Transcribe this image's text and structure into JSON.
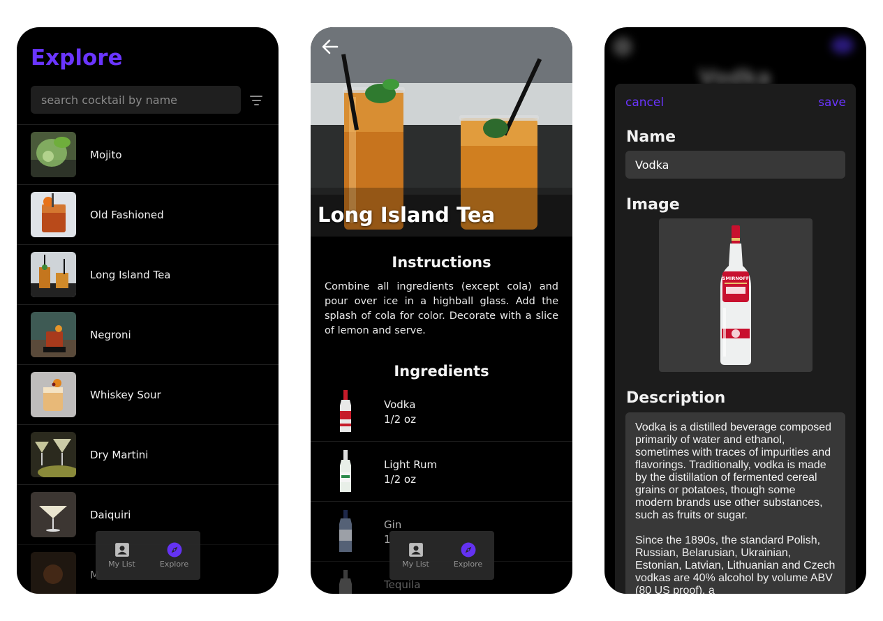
{
  "explore": {
    "title": "Explore",
    "search_placeholder": "search cocktail by name",
    "cocktails": [
      {
        "name": "Mojito"
      },
      {
        "name": "Old Fashioned"
      },
      {
        "name": "Long Island Tea"
      },
      {
        "name": "Negroni"
      },
      {
        "name": "Whiskey Sour"
      },
      {
        "name": "Dry Martini"
      },
      {
        "name": "Daiquiri"
      },
      {
        "name": "M"
      }
    ]
  },
  "nav": {
    "my_list_label": "My List",
    "explore_label": "Explore",
    "active_color": "#6a35ff"
  },
  "detail": {
    "title": "Long Island Tea",
    "instructions_title": "Instructions",
    "instructions": "Combine all ingredients (except cola) and pour over ice in a highball glass. Add the splash of cola for color. Decorate with a slice of lemon and serve.",
    "ingredients_title": "Ingredients",
    "ingredients": [
      {
        "name": "Vodka",
        "amount": "1/2 oz"
      },
      {
        "name": "Light Rum",
        "amount": "1/2 oz"
      },
      {
        "name": "Gin",
        "amount": "1"
      },
      {
        "name": "Tequila",
        "amount": ""
      }
    ]
  },
  "edit": {
    "background_title": "Vodka",
    "cancel_label": "cancel",
    "save_label": "save",
    "name_label": "Name",
    "name_value": "Vodka",
    "image_label": "Image",
    "description_label": "Description",
    "description": "Vodka is a distilled beverage composed primarily of water and ethanol, sometimes with traces of impurities and flavorings. Traditionally, vodka is made by the distillation of fermented cereal grains or potatoes, though some modern brands use other substances, such as fruits or sugar.\n\nSince the 1890s, the standard Polish, Russian, Belarusian, Ukrainian, Estonian, Latvian, Lithuanian and Czech vodkas are 40% alcohol by volume ABV (80 US proof), a",
    "bottle_brand": "SMIRNOFF"
  },
  "colors": {
    "accent": "#6a35ff",
    "background": "#000000",
    "surface": "#1c1c1c"
  }
}
